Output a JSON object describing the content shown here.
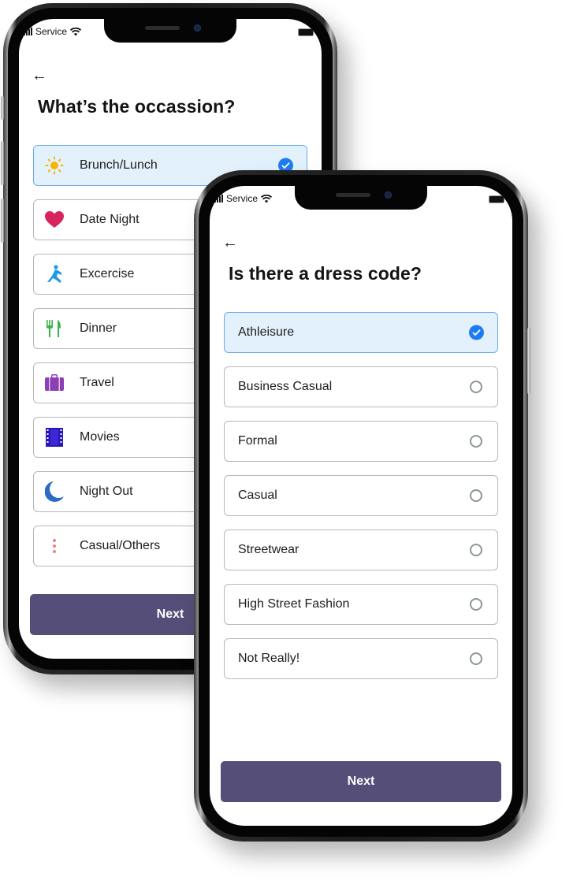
{
  "back_screen": {
    "status_bar": {
      "carrier": "Service"
    },
    "back_icon": "arrow-left-icon",
    "title": "What’s the occassion?",
    "options": [
      {
        "label": "Brunch/Lunch",
        "icon": "sun-icon",
        "icon_color": "#f7b500",
        "selected": true
      },
      {
        "label": "Date Night",
        "icon": "heart-icon",
        "icon_color": "#d7245c",
        "selected": false
      },
      {
        "label": "Excercise",
        "icon": "exercise-icon",
        "icon_color": "#1e9ae6",
        "selected": false
      },
      {
        "label": "Dinner",
        "icon": "fork-knife-icon",
        "icon_color": "#3bb54a",
        "selected": false
      },
      {
        "label": "Travel",
        "icon": "suitcase-icon",
        "icon_color": "#8e3fb5",
        "selected": false
      },
      {
        "label": "Movies",
        "icon": "film-icon",
        "icon_color": "#2a17b8",
        "selected": false
      },
      {
        "label": "Night Out",
        "icon": "moon-icon",
        "icon_color": "#2b6cc0",
        "selected": false
      },
      {
        "label": "Casual/Others",
        "icon": "dots-vertical-icon",
        "icon_color": "#f08080",
        "selected": false
      }
    ],
    "next_label": "Next"
  },
  "front_screen": {
    "status_bar": {
      "carrier": "Service"
    },
    "back_icon": "arrow-left-icon",
    "title": "Is there a dress code?",
    "options": [
      {
        "label": "Athleisure",
        "selected": true
      },
      {
        "label": "Business Casual",
        "selected": false
      },
      {
        "label": "Formal",
        "selected": false
      },
      {
        "label": "Casual",
        "selected": false
      },
      {
        "label": "Streetwear",
        "selected": false
      },
      {
        "label": "High Street Fashion",
        "selected": false
      },
      {
        "label": "Not Really!",
        "selected": false
      }
    ],
    "next_label": "Next"
  },
  "colors": {
    "accent": "#1e7cf2",
    "selected_bg": "#e3f1fd",
    "selected_border": "#6aaaf0",
    "button_bg": "#554e78",
    "radio_border": "#8a9799"
  }
}
